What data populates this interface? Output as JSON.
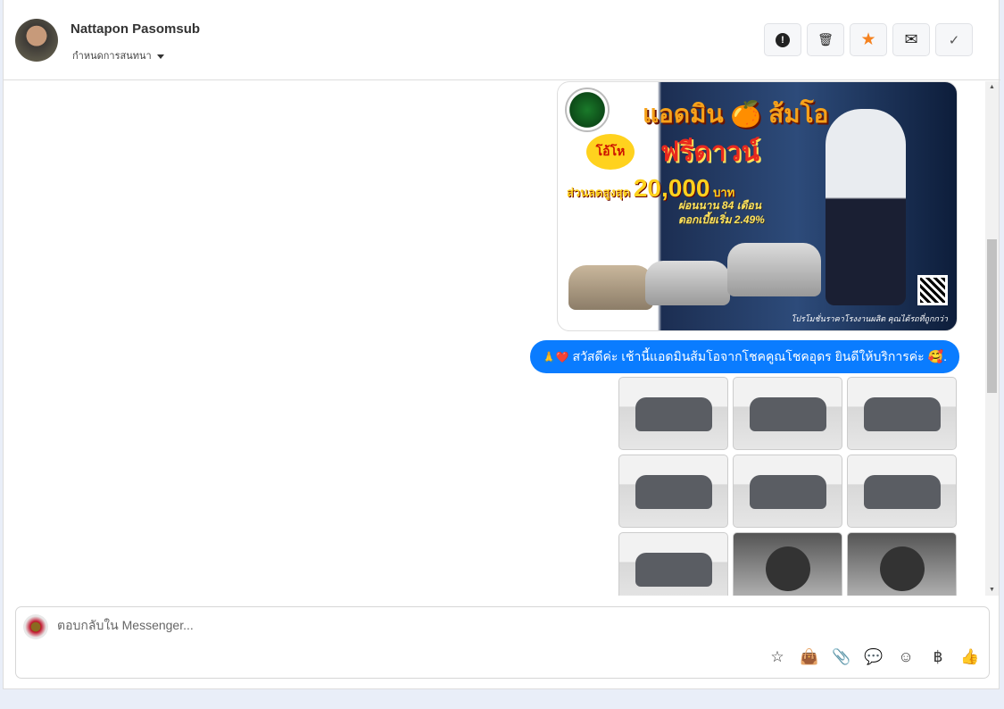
{
  "header": {
    "contact_name": "Nattapon Pasomsub",
    "conversation_menu": "กำหนดการสนทนา",
    "actions": [
      {
        "name": "spam",
        "icon": "!"
      },
      {
        "name": "delete",
        "icon": "🗑"
      },
      {
        "name": "star",
        "icon": "★"
      },
      {
        "name": "mark-unread",
        "icon": "✉"
      },
      {
        "name": "done",
        "icon": "✓"
      }
    ]
  },
  "ad": {
    "title": "แอดมิน 🍊 ส้มโอ",
    "burst": "โอ้โห",
    "headline": "ฟรีดาวน์",
    "discount_label": "ส่วนลดสูงสุด",
    "discount_amount": "20,000",
    "currency": "บาท",
    "installment": "ผ่อนนาน 84 เดือน",
    "interest": "ดอกเบี้ยเริ่ม 2.49%",
    "footer": "โปรโมชั่นราคาโรงงานผลิต คุณได้รถที่ถูกกว่า"
  },
  "message": {
    "emoji": "🙏❤️",
    "text": "สวัสดีค่ะ เช้านี้แอดมินส้มโอจากโชคคูณโชคอุดร ยินดีให้บริการค่ะ",
    "trail": "🥰."
  },
  "composer": {
    "placeholder": "ตอบกลับใน Messenger...",
    "tools": [
      "☆",
      "👜",
      "📎",
      "💬",
      "☺",
      "฿",
      "👍"
    ]
  },
  "colors": {
    "accent": "#0a7cff",
    "star": "#f5821f"
  }
}
